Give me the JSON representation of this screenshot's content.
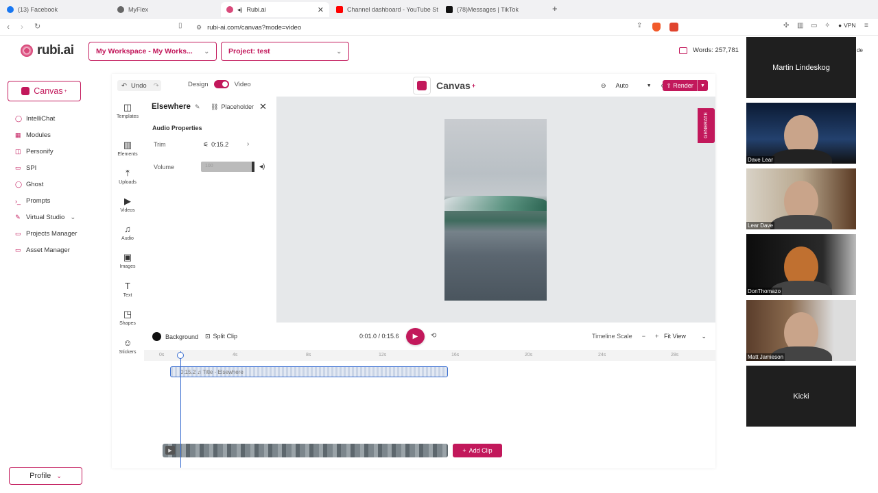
{
  "browser": {
    "tabs": [
      {
        "label": "(13) Facebook",
        "color": "#1877f2"
      },
      {
        "label": "MyFlex",
        "color": "#666666"
      },
      {
        "label": "Rubi.ai",
        "color": "#d94a7b",
        "active": true
      },
      {
        "label": "Channel dashboard - YouTube St",
        "color": "#ff0000"
      },
      {
        "label": "(78)Messages | TikTok",
        "color": "#111111"
      }
    ],
    "url": "rubi-ai.com/canvas?mode=video",
    "vpn_label": "VPN"
  },
  "header": {
    "logo_text": "rubi.ai",
    "workspace_select": "My Workspace - My Works...",
    "project_select": "Project: test",
    "words": "Words: 257,781"
  },
  "sidebar": {
    "canvas_label": "Canvas",
    "canvas_sup": "+",
    "items": [
      {
        "label": "IntelliChat",
        "icon": "chat-icon",
        "glyph": "◯"
      },
      {
        "label": "Modules",
        "icon": "grid-icon",
        "glyph": "▦"
      },
      {
        "label": "Personify",
        "icon": "persona-icon",
        "glyph": "◫"
      },
      {
        "label": "SPI",
        "icon": "spi-icon",
        "glyph": "▭"
      },
      {
        "label": "Ghost",
        "icon": "ghost-icon",
        "glyph": "◯"
      },
      {
        "label": "Prompts",
        "icon": "prompt-icon",
        "glyph": "›_"
      },
      {
        "label": "Virtual Studio",
        "icon": "studio-icon",
        "glyph": "✎"
      },
      {
        "label": "Projects Manager",
        "icon": "folder-icon",
        "glyph": "▭"
      },
      {
        "label": "Asset Manager",
        "icon": "asset-icon",
        "glyph": "▭"
      }
    ],
    "profile_label": "Profile"
  },
  "canvas": {
    "undo_label": "Undo",
    "design_label": "Design",
    "video_label": "Video",
    "title": "Canvas",
    "title_sup": "+",
    "zoom_value": "Auto",
    "render_label": "Render",
    "generate_label": "GENERATE"
  },
  "tools": [
    {
      "label": "Templates",
      "icon": "templates-icon",
      "glyph": "◫"
    },
    {
      "label": "Elements",
      "icon": "elements-icon",
      "glyph": "▥"
    },
    {
      "label": "Uploads",
      "icon": "upload-icon",
      "glyph": "⤒"
    },
    {
      "label": "Videos",
      "icon": "video-icon",
      "glyph": "▶"
    },
    {
      "label": "Audio",
      "icon": "music-icon",
      "glyph": "♫"
    },
    {
      "label": "Images",
      "icon": "image-icon",
      "glyph": "▣"
    },
    {
      "label": "Text",
      "icon": "text-icon",
      "glyph": "T"
    },
    {
      "label": "Shapes",
      "icon": "shapes-icon",
      "glyph": "◳"
    },
    {
      "label": "Stickers",
      "icon": "sticker-icon",
      "glyph": "☺"
    }
  ],
  "properties": {
    "title": "Elsewhere",
    "placeholder_label": "Placeholder",
    "section": "Audio Properties",
    "trim_label": "Trim",
    "trim_value": "0:15.2",
    "volume_label": "Volume",
    "volume_value": "100",
    "volume_level": 1.0
  },
  "controls": {
    "background_label": "Background",
    "split_label": "Split Clip",
    "time": "0:01.0 / 0:15.6",
    "timeline_scale_label": "Timeline Scale",
    "fit_view_label": "Fit View"
  },
  "timeline": {
    "ticks": [
      "0s",
      "4s",
      "8s",
      "12s",
      "16s",
      "20s",
      "24s",
      "28s"
    ],
    "audio_clip_label": "0:15.2 ♫ Title - Elsewhere",
    "add_clip_label": "Add Clip"
  },
  "call": {
    "participants": [
      {
        "name": "Martin Lindeskog",
        "video": false
      },
      {
        "name": "Dave Lear",
        "video": true
      },
      {
        "name": "Lear Dave",
        "video": true
      },
      {
        "name": "DonThomazo",
        "video": true
      },
      {
        "name": "Matt Jamieson",
        "video": true
      },
      {
        "name": "Kicki",
        "video": false
      }
    ]
  }
}
